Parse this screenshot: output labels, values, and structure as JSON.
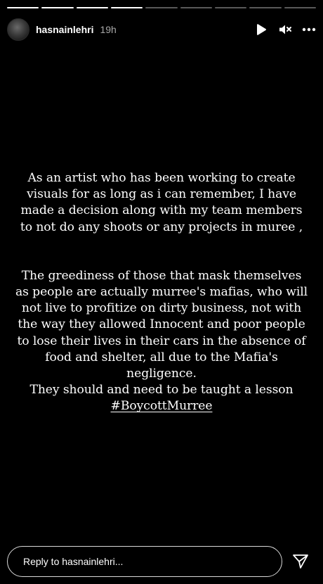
{
  "progress": {
    "segments": [
      1,
      1,
      1,
      1,
      0,
      0,
      0,
      0,
      0
    ]
  },
  "header": {
    "username": "hasnainlehri",
    "time": "19h"
  },
  "story": {
    "paragraphs": [
      "As an artist who has been working to create\nvisuals for as long as i can remember, I have\nmade a decision along with my team members\nto not do any shoots or any projects in muree ,",
      "The greediness of those that mask themselves\nas people are actually murree's mafias, who will\nnot live to profitize on dirty business, not with\nthe way they allowed Innocent and poor people\nto lose  their lives in their cars in the absence of\nfood and shelter, all due to the Mafia's\nnegligence.\nThey should and need to be taught a lesson"
    ],
    "hashtag": "#BoycottMurree"
  },
  "reply": {
    "placeholder": "Reply to hasnainlehri..."
  },
  "icons": {
    "play": "play-icon",
    "mute": "speaker-muted-icon",
    "more": "more-options-icon",
    "send": "send-icon"
  },
  "colors": {
    "background": "#000000",
    "text": "#ffffff",
    "muted_text": "#a6a6a6"
  }
}
